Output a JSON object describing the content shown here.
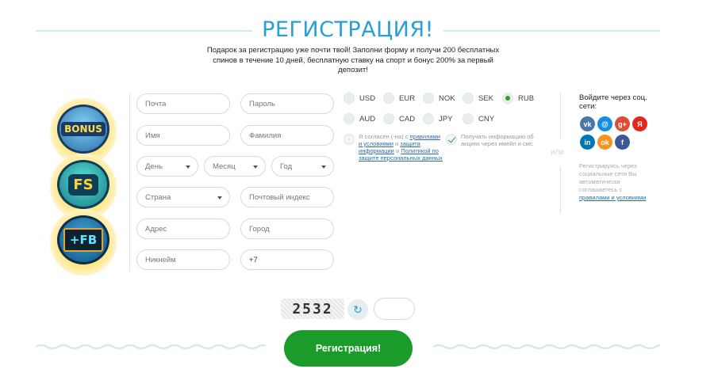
{
  "header": {
    "title": "РЕГИСТРАЦИЯ!",
    "subtitle": "Подарок за регистрацию уже почти твой! Заполни форму и получи 200 бесплатных спинов в течение 10 дней, бесплатную ставку на спорт и бонус 200% за первый депозит!"
  },
  "promo": {
    "badges": [
      "BONUS",
      "FS",
      "+FB"
    ]
  },
  "form": {
    "email_placeholder": "Почта",
    "password_placeholder": "Пароль",
    "first_name_placeholder": "Имя",
    "last_name_placeholder": "Фамилия",
    "day_label": "День",
    "month_label": "Месяц",
    "year_label": "Год",
    "country_label": "Страна",
    "postcode_placeholder": "Почтовый индекс",
    "address_placeholder": "Адрес",
    "city_placeholder": "Город",
    "nickname_placeholder": "Никнейм",
    "phone_value": "+7"
  },
  "currencies": {
    "options": [
      "USD",
      "EUR",
      "NOK",
      "SEK",
      "RUB",
      "AUD",
      "CAD",
      "JPY",
      "CNY"
    ],
    "selected": "RUB"
  },
  "consent": {
    "terms_prefix": "Я согласен (-на) с",
    "terms_link": "правилами и условиями",
    "terms_mid": "и",
    "privacy_link": "защита информации",
    "privacy_mid": "и",
    "policy_link": "Политикой по защите персональных данных",
    "newsletter_text": "Получать информацию об акциях через имейл и смс"
  },
  "divider": {
    "or_text": "или"
  },
  "social": {
    "title": "Войдите через соц. сети:",
    "networks": [
      {
        "icon": "vk-icon",
        "glyph": "vk",
        "color": "#4a76a8"
      },
      {
        "icon": "mailru-icon",
        "glyph": "@",
        "color": "#168de2"
      },
      {
        "icon": "google-plus-icon",
        "glyph": "g+",
        "color": "#dd4b39"
      },
      {
        "icon": "yandex-icon",
        "glyph": "Я",
        "color": "#e52620"
      },
      {
        "icon": "linkedin-icon",
        "glyph": "in",
        "color": "#0077b5"
      },
      {
        "icon": "odnoklassniki-icon",
        "glyph": "ok",
        "color": "#f7931e"
      },
      {
        "icon": "facebook-icon",
        "glyph": "f",
        "color": "#3b5998"
      }
    ],
    "note_prefix": "Регистрируясь через социальные сети Вы автоматически соглашаетесь с",
    "note_link": "правилами и условиями"
  },
  "captcha": {
    "code": "2532",
    "refresh_glyph": "↻"
  },
  "submit": {
    "label": "Регистрация!"
  },
  "colors": {
    "accent": "#2a9fd6",
    "submit": "#1a9b2a",
    "link": "#2a6ea8"
  }
}
